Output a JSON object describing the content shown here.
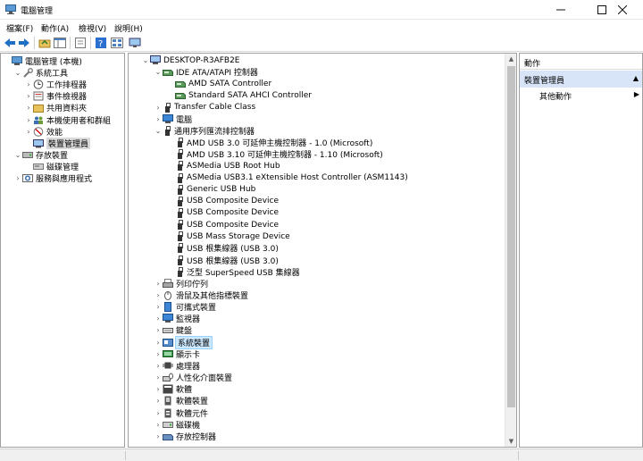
{
  "window": {
    "title": "電腦管理"
  },
  "menu": [
    "檔案(F)",
    "動作(A)",
    "檢視(V)",
    "說明(H)"
  ],
  "left_tree": [
    {
      "label": "電腦管理 (本機)",
      "depth": 0,
      "arrow": "",
      "icon": "computer-management-icon"
    },
    {
      "label": "系統工具",
      "depth": 1,
      "arrow": "expanded",
      "icon": "tools-icon"
    },
    {
      "label": "工作排程器",
      "depth": 2,
      "arrow": "collapsed",
      "icon": "clock-icon"
    },
    {
      "label": "事件檢視器",
      "depth": 2,
      "arrow": "collapsed",
      "icon": "event-viewer-icon"
    },
    {
      "label": "共用資料夾",
      "depth": 2,
      "arrow": "collapsed",
      "icon": "folder-icon"
    },
    {
      "label": "本機使用者和群組",
      "depth": 2,
      "arrow": "collapsed",
      "icon": "users-icon"
    },
    {
      "label": "效能",
      "depth": 2,
      "arrow": "collapsed",
      "icon": "performance-icon"
    },
    {
      "label": "裝置管理員",
      "depth": 2,
      "arrow": "",
      "icon": "device-manager-icon",
      "selected": true
    },
    {
      "label": "存放裝置",
      "depth": 1,
      "arrow": "expanded",
      "icon": "storage-icon"
    },
    {
      "label": "磁碟管理",
      "depth": 2,
      "arrow": "",
      "icon": "disk-icon"
    },
    {
      "label": "服務與應用程式",
      "depth": 1,
      "arrow": "collapsed",
      "icon": "services-icon"
    }
  ],
  "device_tree": [
    {
      "label": "DESKTOP-R3AFB2E",
      "depth": 0,
      "arrow": "expanded",
      "icon": "computer-icon"
    },
    {
      "label": "IDE ATA/ATAPI 控制器",
      "depth": 1,
      "arrow": "expanded",
      "icon": "controller-icon"
    },
    {
      "label": "AMD SATA Controller",
      "depth": 2,
      "arrow": "",
      "icon": "controller-icon"
    },
    {
      "label": "Standard SATA AHCI Controller",
      "depth": 2,
      "arrow": "",
      "icon": "controller-icon"
    },
    {
      "label": "Transfer Cable Class",
      "depth": 1,
      "arrow": "collapsed",
      "icon": "usb-icon"
    },
    {
      "label": "電腦",
      "depth": 1,
      "arrow": "collapsed",
      "icon": "monitor-icon"
    },
    {
      "label": "通用序列匯流排控制器",
      "depth": 1,
      "arrow": "expanded",
      "icon": "usb-icon"
    },
    {
      "label": "AMD USB 3.0 可延伸主機控制器 - 1.0 (Microsoft)",
      "depth": 2,
      "arrow": "",
      "icon": "usb-icon"
    },
    {
      "label": "AMD USB 3.10 可延伸主機控制器 - 1.10 (Microsoft)",
      "depth": 2,
      "arrow": "",
      "icon": "usb-icon"
    },
    {
      "label": "ASMedia USB Root Hub",
      "depth": 2,
      "arrow": "",
      "icon": "usb-icon"
    },
    {
      "label": "ASMedia USB3.1 eXtensible Host Controller (ASM1143)",
      "depth": 2,
      "arrow": "",
      "icon": "usb-icon"
    },
    {
      "label": "Generic USB Hub",
      "depth": 2,
      "arrow": "",
      "icon": "usb-icon"
    },
    {
      "label": "USB Composite Device",
      "depth": 2,
      "arrow": "",
      "icon": "usb-icon"
    },
    {
      "label": "USB Composite Device",
      "depth": 2,
      "arrow": "",
      "icon": "usb-icon"
    },
    {
      "label": "USB Composite Device",
      "depth": 2,
      "arrow": "",
      "icon": "usb-icon"
    },
    {
      "label": "USB Mass Storage Device",
      "depth": 2,
      "arrow": "",
      "icon": "usb-icon"
    },
    {
      "label": "USB 根集線器 (USB 3.0)",
      "depth": 2,
      "arrow": "",
      "icon": "usb-icon"
    },
    {
      "label": "USB 根集線器 (USB 3.0)",
      "depth": 2,
      "arrow": "",
      "icon": "usb-icon"
    },
    {
      "label": "泛型 SuperSpeed USB 集線器",
      "depth": 2,
      "arrow": "",
      "icon": "usb-icon"
    },
    {
      "label": "列印佇列",
      "depth": 1,
      "arrow": "collapsed",
      "icon": "printer-icon"
    },
    {
      "label": "滑鼠及其他指標裝置",
      "depth": 1,
      "arrow": "collapsed",
      "icon": "mouse-icon"
    },
    {
      "label": "可攜式裝置",
      "depth": 1,
      "arrow": "collapsed",
      "icon": "portable-device-icon"
    },
    {
      "label": "監視器",
      "depth": 1,
      "arrow": "collapsed",
      "icon": "monitor-icon"
    },
    {
      "label": "鍵盤",
      "depth": 1,
      "arrow": "collapsed",
      "icon": "keyboard-icon"
    },
    {
      "label": "系統裝置",
      "depth": 1,
      "arrow": "collapsed",
      "icon": "system-device-icon",
      "highlighted": true
    },
    {
      "label": "顯示卡",
      "depth": 1,
      "arrow": "collapsed",
      "icon": "display-adapter-icon"
    },
    {
      "label": "處理器",
      "depth": 1,
      "arrow": "collapsed",
      "icon": "processor-icon"
    },
    {
      "label": "人性化介面裝置",
      "depth": 1,
      "arrow": "collapsed",
      "icon": "hid-icon"
    },
    {
      "label": "軟體",
      "depth": 1,
      "arrow": "collapsed",
      "icon": "software-icon"
    },
    {
      "label": "軟體裝置",
      "depth": 1,
      "arrow": "collapsed",
      "icon": "software-device-icon"
    },
    {
      "label": "軟體元件",
      "depth": 1,
      "arrow": "collapsed",
      "icon": "software-component-icon"
    },
    {
      "label": "磁碟機",
      "depth": 1,
      "arrow": "collapsed",
      "icon": "disk-drive-icon"
    },
    {
      "label": "存放控制器",
      "depth": 1,
      "arrow": "collapsed",
      "icon": "storage-controller-icon"
    }
  ],
  "actions": {
    "header": "動作",
    "section": "裝置管理員",
    "item": "其他動作"
  },
  "colors": {
    "selection": "#d9d9d9",
    "highlight": "#cce8ff",
    "action_section": "#d8e4f8"
  }
}
